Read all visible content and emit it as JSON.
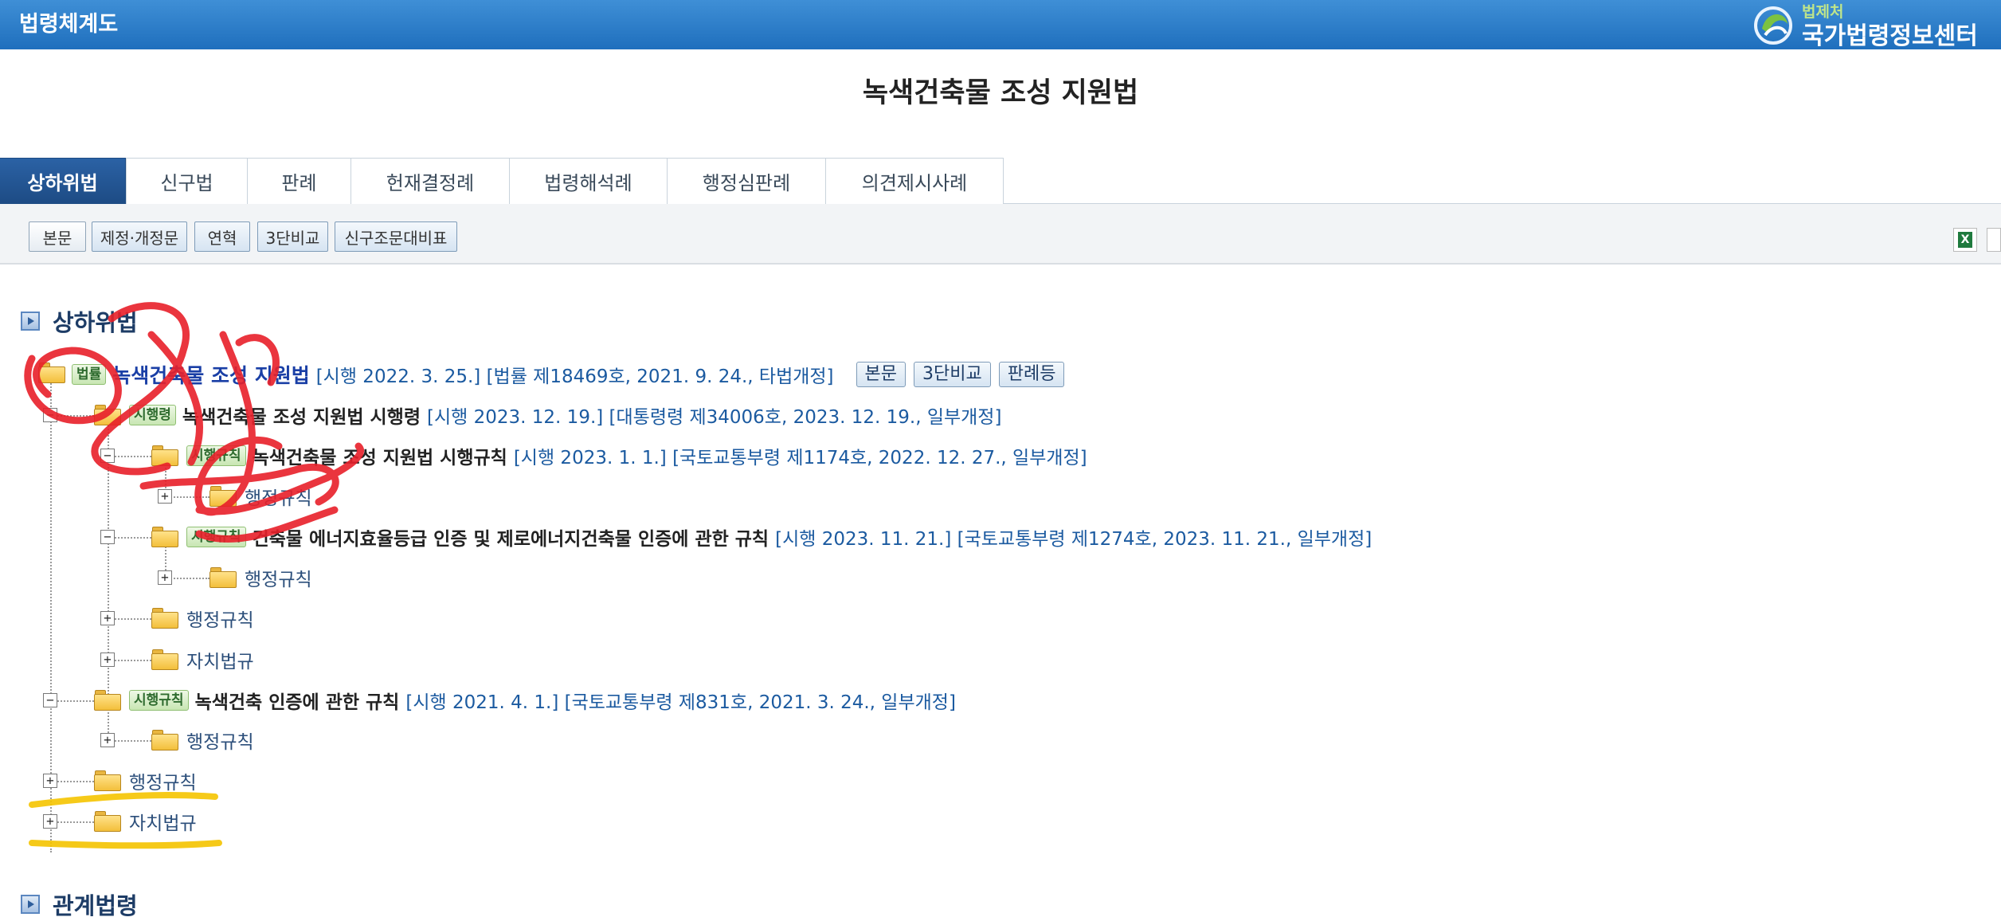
{
  "header": {
    "app_title": "법령체계도",
    "brand_sub": "법제처",
    "brand_main": "국가법령정보센터"
  },
  "document": {
    "title": "녹색건축물 조성 지원법"
  },
  "tabs": [
    {
      "label": "상하위법",
      "active": true
    },
    {
      "label": "신구법"
    },
    {
      "label": "판례"
    },
    {
      "label": "헌재결정례"
    },
    {
      "label": "법령해석례"
    },
    {
      "label": "행정심판례"
    },
    {
      "label": "의견제시사례"
    }
  ],
  "toolbar": {
    "buttons": [
      "본문",
      "제정·개정문",
      "연혁",
      "3단비교",
      "신구조문대비표"
    ],
    "excel_icon": "excel-icon",
    "print_icon": "print-icon"
  },
  "sections": {
    "upper_lower": "상하위법",
    "related": "관계법령"
  },
  "tree": {
    "root": {
      "badge": "법률",
      "name": "녹색건축물 조성 지원법",
      "meta": "[시행 2022. 3. 25.] [법률 제18469호, 2021. 9. 24., 타법개정]",
      "buttons": [
        "본문",
        "3단비교",
        "판례등"
      ]
    },
    "decree": {
      "badge": "시행령",
      "name": "녹색건축물 조성 지원법 시행령",
      "meta": "[시행 2023. 12. 19.] [대통령령 제34006호, 2023. 12. 19., 일부개정]"
    },
    "rule1": {
      "badge": "시행규칙",
      "name": "녹색건축물 조성 지원법 시행규칙",
      "meta": "[시행 2023. 1. 1.] [국토교통부령 제1174호, 2022. 12. 27., 일부개정]",
      "child": "행정규칙"
    },
    "rule2": {
      "badge": "시행규칙",
      "name": "건축물 에너지효율등급 인증 및 제로에너지건축물 인증에 관한 규칙",
      "meta": "[시행 2023. 11. 21.] [국토교통부령 제1274호, 2023. 11. 21., 일부개정]",
      "child": "행정규칙"
    },
    "decree_admin": "행정규칙",
    "decree_local": "자치법규",
    "rule3": {
      "badge": "시행규칙",
      "name": "녹색건축 인증에 관한 규칙",
      "meta": "[시행 2021. 4. 1.] [국토교통부령 제831호, 2021. 3. 24., 일부개정]",
      "child": "행정규칙"
    },
    "root_admin": "행정규칙",
    "root_local": "자치법규"
  },
  "colors": {
    "header_blue": "#1f6fbd",
    "active_tab": "#1d4b84",
    "annotation_red": "#e8202a",
    "annotation_yellow": "#f5c400"
  }
}
